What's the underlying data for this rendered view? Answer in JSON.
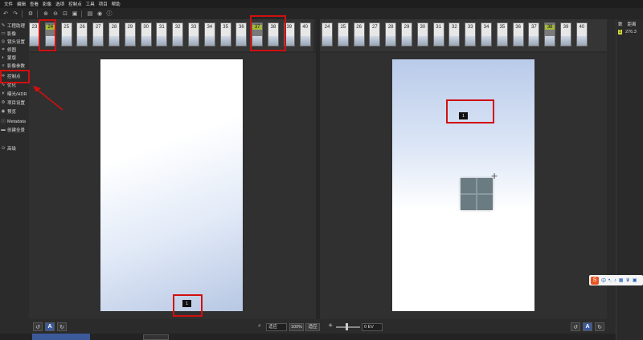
{
  "menu": [
    "文件",
    "编辑",
    "查看",
    "影像",
    "选项",
    "控制点",
    "工具",
    "项目",
    "帮助"
  ],
  "toolbar_icons": [
    "undo-icon",
    "redo-icon",
    "settings-icon",
    "zoom-in-icon",
    "zoom-out-icon",
    "zoom-fit-icon",
    "zoom-actual-icon",
    "compare-icon",
    "pin-icon",
    "help-icon"
  ],
  "sidebar": {
    "items": [
      {
        "label": "工程助理",
        "icon": "wand-icon"
      },
      {
        "label": "影像",
        "icon": "image-icon"
      },
      {
        "label": "镜头设置",
        "icon": "lens-icon"
      },
      {
        "label": "修图",
        "icon": "crop-icon"
      },
      {
        "label": "蒙版",
        "icon": "mask-icon"
      },
      {
        "label": "影像参数",
        "icon": "sliders-icon"
      },
      {
        "label": "控制点",
        "icon": "control-point-icon"
      },
      {
        "label": "优化",
        "icon": "optimize-icon"
      },
      {
        "label": "曝光/HDR",
        "icon": "exposure-icon"
      },
      {
        "label": "项目设置",
        "icon": "project-settings-icon"
      },
      {
        "label": "预览",
        "icon": "eye-icon"
      },
      {
        "label": "Metadata",
        "icon": "info-icon"
      },
      {
        "label": "创建全景",
        "icon": "panorama-icon"
      },
      {
        "label": "高级",
        "icon": "advanced-icon"
      }
    ]
  },
  "filmstrip_left": {
    "numbers": [
      "23",
      "24",
      "25",
      "26",
      "27",
      "28",
      "29",
      "30",
      "31",
      "32",
      "33",
      "34",
      "35",
      "36",
      "37",
      "38",
      "39",
      "40"
    ],
    "selected": "24",
    "highlight": "37"
  },
  "filmstrip_right": {
    "numbers": [
      "24",
      "25",
      "26",
      "27",
      "28",
      "29",
      "30",
      "31",
      "32",
      "33",
      "34",
      "35",
      "36",
      "37",
      "38",
      "39",
      "40"
    ],
    "selected": "38"
  },
  "control_points": {
    "left_label": "1",
    "right_label": "1"
  },
  "bottom": {
    "zoom_fit": "适应",
    "zoom_pct": "100%",
    "zoom_fit2": "适应",
    "ev": "0 EV",
    "auto_label": "A"
  },
  "sidepanel": {
    "header_num": "数",
    "header_dist": "距离",
    "row_num": "1",
    "row_dist": "276.3"
  },
  "ime": {
    "logo": "S",
    "lang": "中"
  },
  "colors": {
    "accent_red": "#d10f0f",
    "selected_thumb": "#a6b83a",
    "button_blue": "#3c5a9a"
  }
}
